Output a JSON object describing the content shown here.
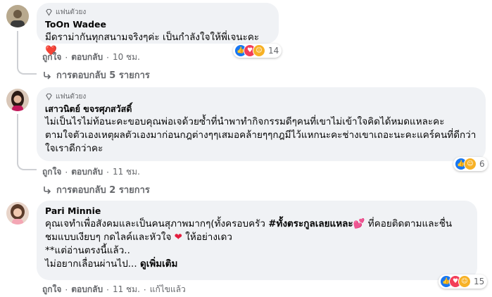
{
  "comments": [
    {
      "badge": "แฟนตัวยง",
      "author": "ToOn Wadee",
      "text": "มีดราม่ากันทุกสนามจริงๆค่ะ เป็นกำลังใจให้พี่เจนะคะ",
      "emoji": "❤️",
      "actions": {
        "like": "ถูกใจ",
        "reply": "ตอบกลับ",
        "time": "10 ชม."
      },
      "reactions_count": "14",
      "replies": "การตอบกลับ 5 รายการ"
    },
    {
      "badge": "แฟนตัวยง",
      "author": "เสาวนิตย์ ขจรศุภสวัสดิ์",
      "text_lines": [
        "ไม่เป็นไรไม่ท้อนะคะขอบคุณพ่อเจด้วยซ้ำที่นำพาทำกิจกรรมดีๆคนที่เขาไม่เข้าใจคิดได้หมดแหละคะ",
        "ตามใจตัวเองเหตุผลตัวเองมาก่อนกฎต่างๆๆเสมอคล้ายๆๆกฎมีไว้แหกนะคะช่างเขาเถอะนะคะแคร์คนที่ดีกว่า",
        "ใจเราดีกว่าคะ"
      ],
      "actions": {
        "like": "ถูกใจ",
        "reply": "ตอบกลับ",
        "time": "11 ชม."
      },
      "reactions_count": "6",
      "replies": "การตอบกลับ 2 รายการ"
    },
    {
      "author": "Pari Minnie",
      "line1_pre": "คุณเจทำเพื่อสังคมและเป็นคนสุภาพมากๆ(ทั้งครอบครัว ",
      "hashtag": "#ทั้งตระกูลเลยแหละ",
      "line1_post": " ที่คอยติดตามและชื่น",
      "line2_pre": "ชมแบบเงียบๆ กดไลค์และหัวใจ ",
      "line2_post": " ให้อย่างเดว",
      "line3": "**แต่อ่านตรงนี้แล้ว..",
      "line4_pre": "ไม่อยากเลื่อนผ่านไป... ",
      "see_more": "ดูเพิ่มเติม",
      "heart": "❤",
      "actions": {
        "like": "ถูกใจ",
        "reply": "ตอบกลับ",
        "time": "11 ชม.",
        "edited": "แก้ไขแล้ว"
      },
      "reactions_count": "15"
    }
  ],
  "colors": {
    "bubble": "#f0f2f5",
    "meta": "#65676b",
    "like": "#1877f2",
    "love": "#f33e58",
    "care": "#f7b125"
  }
}
